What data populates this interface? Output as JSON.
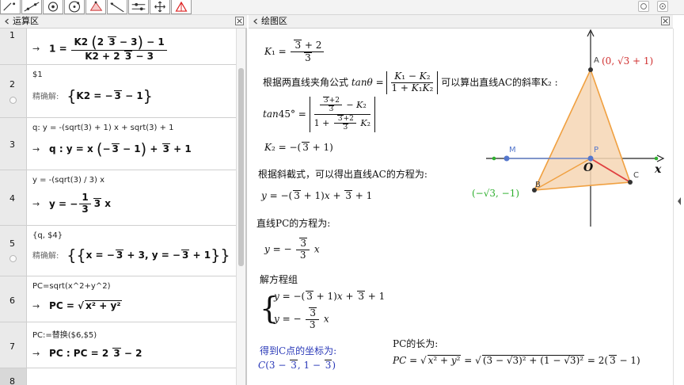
{
  "toolbar": {
    "tools": [
      {
        "name": "move-tool",
        "active": false
      },
      {
        "name": "point-tool",
        "active": false
      },
      {
        "name": "point-on-object-tool",
        "active": false
      },
      {
        "name": "polygon-tool",
        "active": false
      },
      {
        "name": "line-tool",
        "active": false
      },
      {
        "name": "slider-tool",
        "active": false
      },
      {
        "name": "move-graphics-tool",
        "active": false
      },
      {
        "name": "triangle-tool",
        "active": true
      }
    ]
  },
  "cas_panel": {
    "title": "运算区",
    "rows": [
      {
        "num": "1",
        "input": "",
        "output": "1 = K2 (2√3 − 3) − 1 / K2 + 2√3 − 3"
      },
      {
        "num": "2",
        "input": "$1",
        "label": "精确解:",
        "output": "{K2 = −√3 − 1}"
      },
      {
        "num": "3",
        "input": "q: y = -(sqrt(3) + 1) x + sqrt(3) + 1",
        "output": "q : y = x (−√3 − 1) + √3 + 1"
      },
      {
        "num": "4",
        "input": "y = -(sqrt(3) / 3) x",
        "output": "y = −1/3 √3 x"
      },
      {
        "num": "5",
        "input": "{q, $4}",
        "label": "精确解:",
        "output": "{{x = −√3 + 3, y = −√3 + 1}}"
      },
      {
        "num": "6",
        "input": "PC=sqrt(x^2+y^2)",
        "output": "PC = √(x² + y²)"
      },
      {
        "num": "7",
        "input": "PC:=替换($6,$5)",
        "output": "PC : PC = 2√3 − 2"
      },
      {
        "num": "8",
        "input": "",
        "output": ""
      }
    ]
  },
  "graphics_panel": {
    "title": "绘图区",
    "notes": {
      "k1": "K₁ = (√3 + 2) / √3",
      "formula_prefix": "根据两直线夹角公式",
      "formula_suffix": "可以算出直线AC的斜率K₂ :",
      "tan45": "tan45° = |((√3+2)/√3 − K₂) / (1 + ((√3+2)/√3) K₂)|",
      "k2": "K₂ = −(√3 + 1)",
      "slope_intercept": "根据斜截式，可以得出直线AC的方程为:",
      "ac_eq": "y = −(√3 + 1)x + √3 + 1",
      "pc_heading": "直线PC的方程为:",
      "pc_eq": "y = −(√3/3) x",
      "solve": "解方程组",
      "sys1": "y = −(√3 + 1)x + √3 + 1",
      "sys2": "y = −(√3/3) x",
      "c_coord_label": "得到C点的坐标为:",
      "c_coord": "C(3 − √3, 1 − √3)",
      "pc_len_label": "PC的长为:",
      "pc_len": "PC = √(x² + y²) = √((3 − √3)² + (1 − √3)²) = 2(√3 − 1)"
    },
    "figure": {
      "points": {
        "A": {
          "label": "A",
          "coord": "(0, √3 + 1)"
        },
        "B": {
          "label": "B",
          "coord": "(−√3, −1)"
        },
        "C": {
          "label": "C"
        },
        "P": {
          "label": "P"
        },
        "M": {
          "label": "M"
        },
        "O": {
          "label": "O"
        }
      },
      "x_axis_label": "x",
      "colors": {
        "triangle_fill": "#f6d6b4",
        "triangle_edge": "#f0a040",
        "pc_segment": "#e04040",
        "a_label": "#d03030",
        "b_label": "#30b030",
        "point_blue": "#5577cc"
      }
    }
  }
}
